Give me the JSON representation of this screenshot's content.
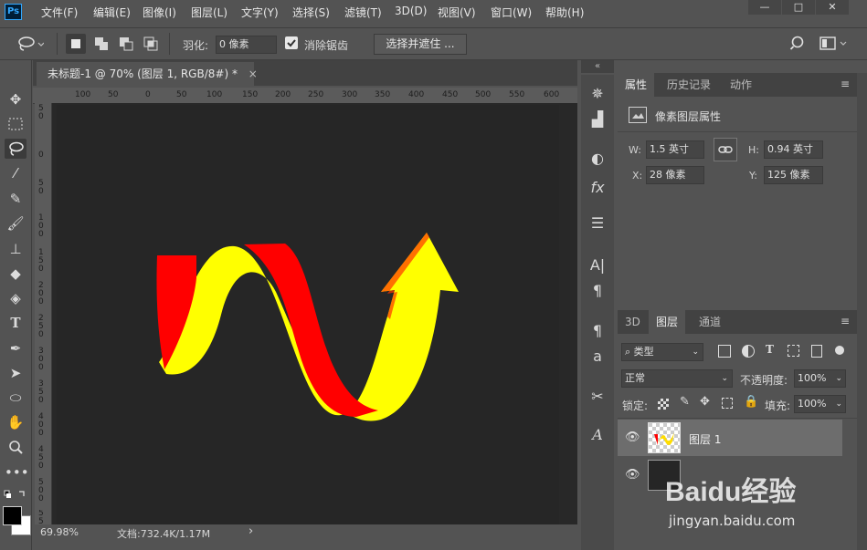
{
  "app": {
    "logo": "Ps"
  },
  "menu": [
    "文件(F)",
    "编辑(E)",
    "图像(I)",
    "图层(L)",
    "文字(Y)",
    "选择(S)",
    "滤镜(T)",
    "3D(D)",
    "视图(V)",
    "窗口(W)",
    "帮助(H)"
  ],
  "window_controls": {
    "minimize": "—",
    "maximize": "□",
    "close": "✕"
  },
  "options": {
    "feather_label": "羽化:",
    "feather_value": "0 像素",
    "antialias_label": "消除锯齿",
    "select_mask_button": "选择并遮住 ..."
  },
  "document": {
    "tab_title": "未标题-1 @ 70% (图层 1, RGB/8#) *",
    "tab_close": "×",
    "ruler_top": [
      "100",
      "50",
      "0",
      "50",
      "100",
      "150",
      "200",
      "250",
      "300",
      "350",
      "400",
      "450",
      "500",
      "550",
      "600"
    ],
    "ruler_left": [
      "5 0",
      "0",
      "5 0",
      "1 0 0",
      "1 5 0",
      "2 0 0",
      "2 5 0",
      "3 0 0",
      "3 5 0",
      "4 0 0",
      "4 5 0",
      "5 0 0",
      "5 5 0"
    ],
    "zoom": "69.98%",
    "doc_info": "文档:732.4K/1.17M",
    "arrow_colors": {
      "red": "#ff0000",
      "yellow": "#ffff00"
    }
  },
  "properties_panel": {
    "tabs": [
      "属性",
      "历史记录",
      "动作"
    ],
    "title": "像素图层属性",
    "w_label": "W:",
    "w_value": "1.5 英寸",
    "h_label": "H:",
    "h_value": "0.94 英寸",
    "x_label": "X:",
    "x_value": "28 像素",
    "y_label": "Y:",
    "y_value": "125 像素"
  },
  "layers_panel": {
    "tabs": [
      "3D",
      "图层",
      "通道"
    ],
    "filter_label": "类型",
    "blend_mode": "正常",
    "opacity_label": "不透明度:",
    "opacity_value": "100%",
    "lock_label": "锁定:",
    "fill_label": "填充:",
    "fill_value": "100%",
    "layers": [
      {
        "name": "图层 1"
      }
    ]
  },
  "watermark": {
    "text": "Baidu经验",
    "url": "jingyan.baidu.com"
  }
}
